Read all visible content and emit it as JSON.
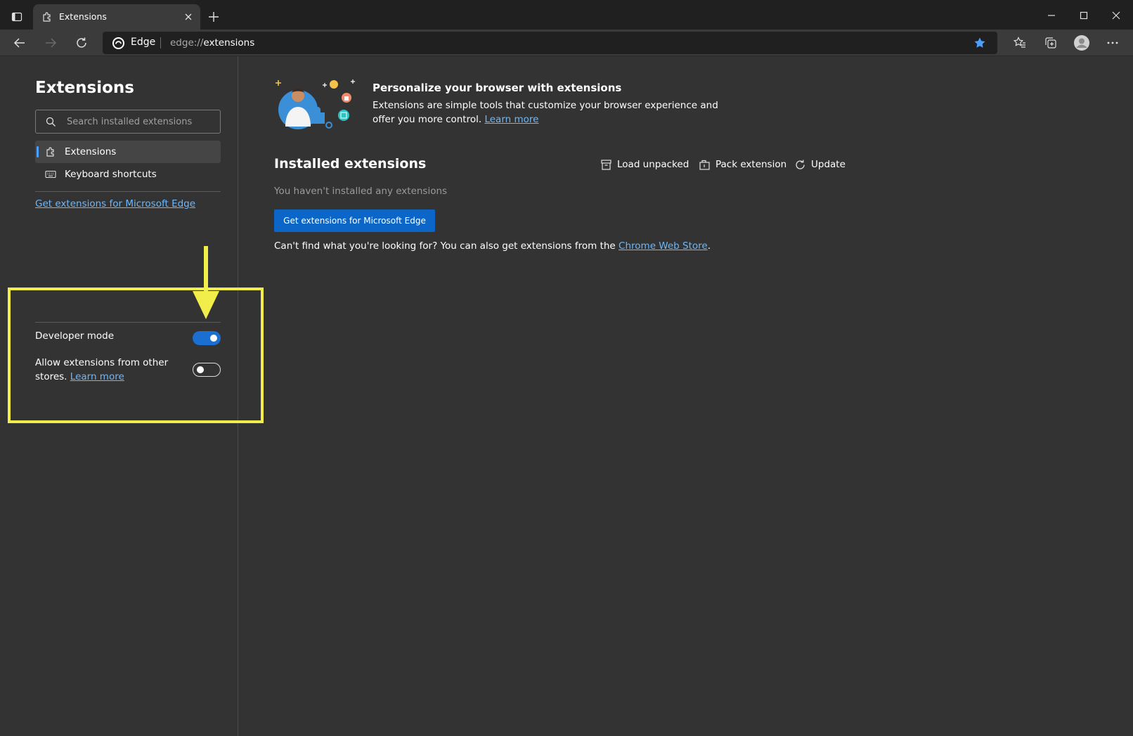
{
  "browser": {
    "tab_title": "Extensions",
    "address_brand": "Edge",
    "url_scheme": "edge://",
    "url_host": "extensions"
  },
  "icons": {
    "tab_actions": "tab-actions-icon",
    "tab": "puzzle-icon",
    "close": "close-icon",
    "new_tab": "plus-icon",
    "minimize": "minimize-icon",
    "maximize": "maximize-icon",
    "window_close": "close-window-icon",
    "back": "back-arrow-icon",
    "forward": "forward-arrow-icon",
    "refresh": "refresh-icon",
    "favorite": "star-icon",
    "favorites": "favorites-icon",
    "collections": "collections-icon",
    "profile": "profile-icon",
    "more": "more-icon"
  },
  "colors": {
    "accent": "#1a6fd1",
    "link": "#6ab8ff",
    "highlight": "#f1ee4b",
    "background": "#333333"
  },
  "sidebar": {
    "title": "Extensions",
    "search_placeholder": "Search installed extensions",
    "nav": [
      {
        "label": "Extensions",
        "active": true
      },
      {
        "label": "Keyboard shortcuts",
        "active": false
      }
    ],
    "get_link": "Get extensions for Microsoft Edge",
    "developer_mode_label": "Developer mode",
    "developer_mode_on": true,
    "allow_other_stores_text": "Allow extensions from other stores.",
    "allow_other_stores_link": "Learn more",
    "allow_other_stores_on": false
  },
  "main": {
    "hero_title": "Personalize your browser with extensions",
    "hero_desc": "Extensions are simple tools that customize your browser experience and offer you more control.",
    "hero_link": "Learn more",
    "installed_title": "Installed extensions",
    "actions": [
      {
        "label": "Load unpacked",
        "icon": "archive-box-icon"
      },
      {
        "label": "Pack extension",
        "icon": "pack-icon"
      },
      {
        "label": "Update",
        "icon": "refresh-icon"
      }
    ],
    "empty_note": "You haven't installed any extensions",
    "get_button": "Get extensions for Microsoft Edge",
    "cant_find_text": "Can't find what you're looking for? You can also get extensions from the",
    "cant_find_link": "Chrome Web Store",
    "cant_find_end": "."
  }
}
